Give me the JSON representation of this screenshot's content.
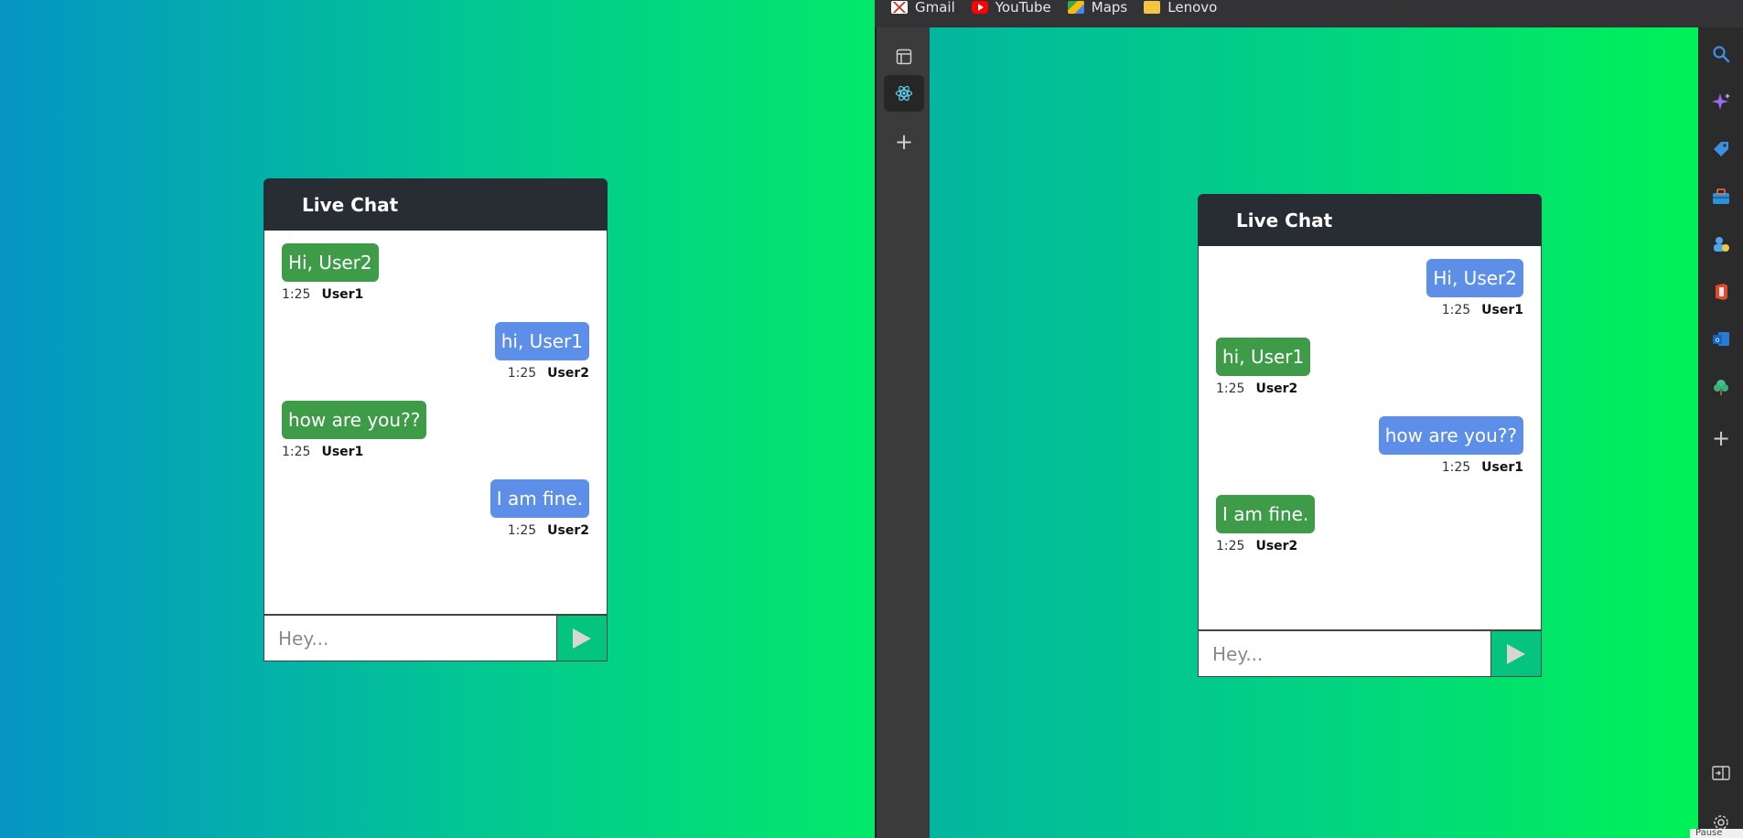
{
  "bookmarks": [
    {
      "label": "Gmail",
      "icon": "gmail-icon"
    },
    {
      "label": "YouTube",
      "icon": "youtube-icon"
    },
    {
      "label": "Maps",
      "icon": "maps-icon"
    },
    {
      "label": "Lenovo",
      "icon": "folder-icon"
    }
  ],
  "left_chat": {
    "title": "Live Chat",
    "placeholder": "Hey...",
    "messages": [
      {
        "text": "Hi, User2",
        "time": "1:25",
        "user": "User1",
        "side": "left",
        "color": "#3e9c49"
      },
      {
        "text": "hi, User1",
        "time": "1:25",
        "user": "User2",
        "side": "right",
        "color": "#5d8ee8"
      },
      {
        "text": "how are you??",
        "time": "1:25",
        "user": "User1",
        "side": "left",
        "color": "#3e9c49"
      },
      {
        "text": "I am fine.",
        "time": "1:25",
        "user": "User2",
        "side": "right",
        "color": "#5d8ee8"
      }
    ]
  },
  "right_chat": {
    "title": "Live Chat",
    "placeholder": "Hey...",
    "messages": [
      {
        "text": "Hi, User2",
        "time": "1:25",
        "user": "User1",
        "side": "right",
        "color": "#5d8ee8"
      },
      {
        "text": "hi, User1",
        "time": "1:25",
        "user": "User2",
        "side": "left",
        "color": "#3e9c49"
      },
      {
        "text": "how are you??",
        "time": "1:25",
        "user": "User1",
        "side": "right",
        "color": "#5d8ee8"
      },
      {
        "text": "I am fine.",
        "time": "1:25",
        "user": "User2",
        "side": "left",
        "color": "#3e9c49"
      }
    ]
  },
  "sidebar_icons": [
    "search-icon",
    "copilot-sparkle-icon",
    "shopping-tag-icon",
    "toolbox-icon",
    "games-icon",
    "office-icon",
    "outlook-icon",
    "tree-icon",
    "add-icon",
    "split-screen-icon",
    "settings-icon"
  ],
  "tooltip": "Pause"
}
